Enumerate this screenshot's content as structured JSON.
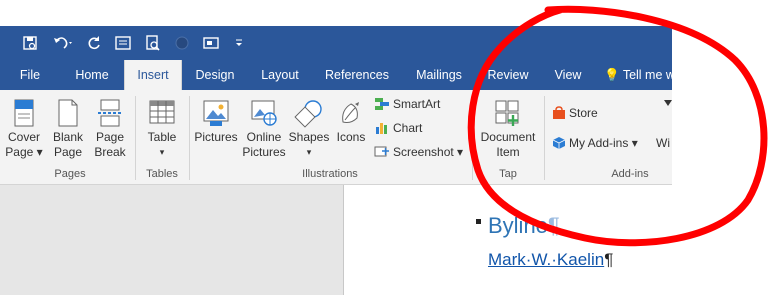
{
  "quick_access": {
    "icons": [
      "save-icon",
      "undo-icon",
      "redo-icon",
      "print-layout-icon",
      "print-preview-icon",
      "circle-icon",
      "screen-icon",
      "customize-icon"
    ]
  },
  "tabs": [
    "File",
    "Home",
    "Insert",
    "Design",
    "Layout",
    "References",
    "Mailings",
    "Review",
    "View",
    "Tell me w"
  ],
  "ribbon": {
    "cover_page": [
      "Cover",
      "Page ▾"
    ],
    "blank_page": [
      "Blank",
      "Page"
    ],
    "page_break": [
      "Page",
      "Break"
    ],
    "pages_group": "Pages",
    "table": [
      "Table",
      "▾"
    ],
    "tables_group": "Tables",
    "pictures": [
      "Pictures"
    ],
    "online_pictures": [
      "Online",
      "Pictures"
    ],
    "shapes": [
      "Shapes",
      "▾"
    ],
    "icons_btn": [
      "Icons"
    ],
    "smartart": "SmartArt",
    "chart": "Chart",
    "screenshot": "Screenshot ▾",
    "illustrations_group": "Illustrations",
    "document_item": [
      "Document",
      "Item"
    ],
    "tap_group": "Tap",
    "store": "Store",
    "my_addins": "My Add-ins ▾",
    "wiki": "Wi",
    "addins_group": "Add-ins"
  },
  "document": {
    "byline": "Byline",
    "author": "Mark·W.·Kaelin",
    "pilcrow": "¶"
  },
  "colors": {
    "accent": "#2b579a",
    "annotation": "#ff0000"
  }
}
